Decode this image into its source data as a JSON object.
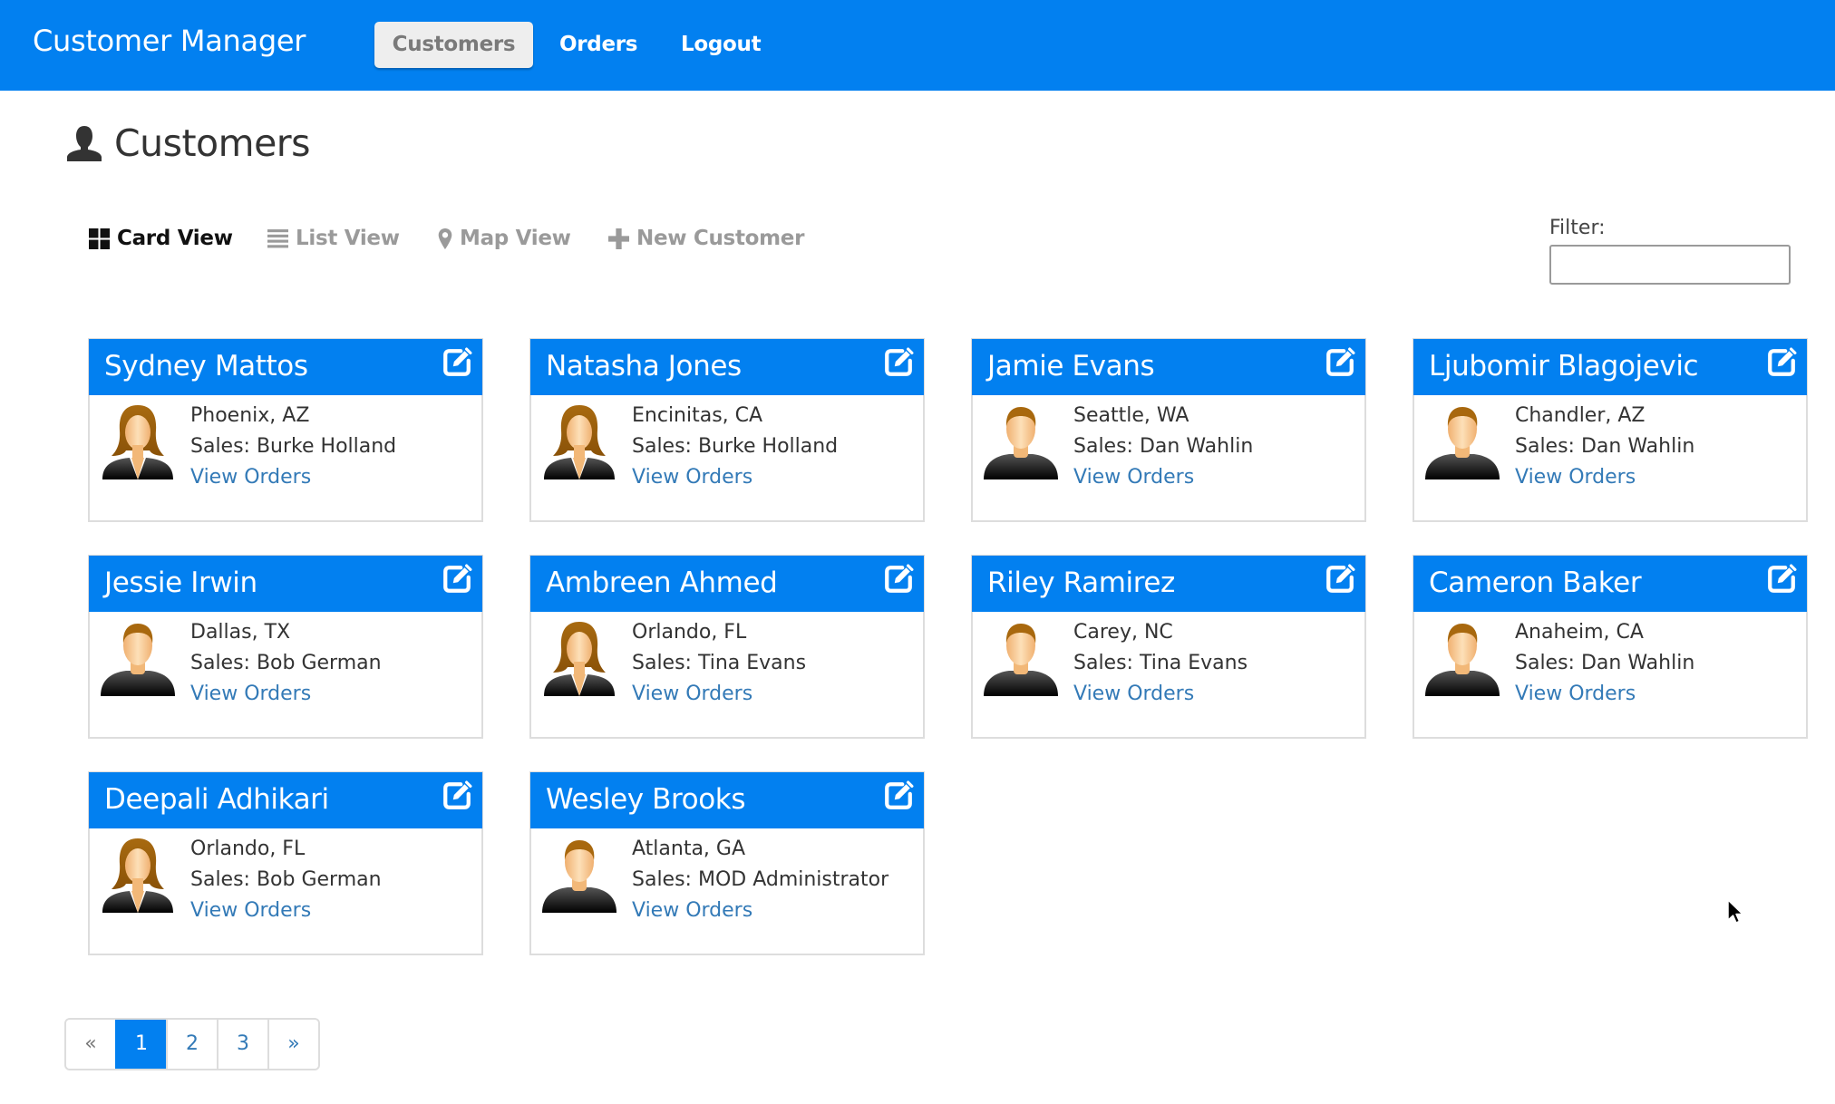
{
  "navbar": {
    "brand": "Customer Manager",
    "links": [
      {
        "label": "Customers",
        "active": true
      },
      {
        "label": "Orders",
        "active": false
      },
      {
        "label": "Logout",
        "active": false
      }
    ]
  },
  "page": {
    "title": "Customers",
    "title_icon": "user-icon"
  },
  "view_tabs": [
    {
      "label": "Card View",
      "icon": "th-large-icon",
      "active": true
    },
    {
      "label": "List View",
      "icon": "list-icon",
      "active": false
    },
    {
      "label": "Map View",
      "icon": "map-marker-icon",
      "active": false
    },
    {
      "label": "New Customer",
      "icon": "plus-icon",
      "active": false
    }
  ],
  "filter": {
    "label": "Filter:",
    "value": "",
    "placeholder": ""
  },
  "customers": [
    {
      "name": "Sydney Mattos",
      "location": "Phoenix, AZ",
      "sales": "Sales: Burke Holland",
      "link": "View Orders",
      "gender": "female"
    },
    {
      "name": "Natasha Jones",
      "location": "Encinitas, CA",
      "sales": "Sales: Burke Holland",
      "link": "View Orders",
      "gender": "female"
    },
    {
      "name": "Jamie Evans",
      "location": "Seattle, WA",
      "sales": "Sales: Dan Wahlin",
      "link": "View Orders",
      "gender": "male"
    },
    {
      "name": "Ljubomir Blagojevic",
      "location": "Chandler, AZ",
      "sales": "Sales: Dan Wahlin",
      "link": "View Orders",
      "gender": "male"
    },
    {
      "name": "Jessie Irwin",
      "location": "Dallas, TX",
      "sales": "Sales: Bob German",
      "link": "View Orders",
      "gender": "male"
    },
    {
      "name": "Ambreen Ahmed",
      "location": "Orlando, FL",
      "sales": "Sales: Tina Evans",
      "link": "View Orders",
      "gender": "female"
    },
    {
      "name": "Riley Ramirez",
      "location": "Carey, NC",
      "sales": "Sales: Tina Evans",
      "link": "View Orders",
      "gender": "male"
    },
    {
      "name": "Cameron Baker",
      "location": "Anaheim, CA",
      "sales": "Sales: Dan Wahlin",
      "link": "View Orders",
      "gender": "male"
    },
    {
      "name": "Deepali Adhikari",
      "location": "Orlando, FL",
      "sales": "Sales: Bob German",
      "link": "View Orders",
      "gender": "female"
    },
    {
      "name": "Wesley Brooks",
      "location": "Atlanta, GA",
      "sales": "Sales: MOD Administrator",
      "link": "View Orders",
      "gender": "male"
    }
  ],
  "pagination": {
    "prev": "«",
    "pages": [
      "1",
      "2",
      "3"
    ],
    "current": "1",
    "next": "»"
  },
  "colors": {
    "primary": "#0280f0",
    "link": "#337ab7",
    "active_nav_bg": "#eeeeee"
  }
}
